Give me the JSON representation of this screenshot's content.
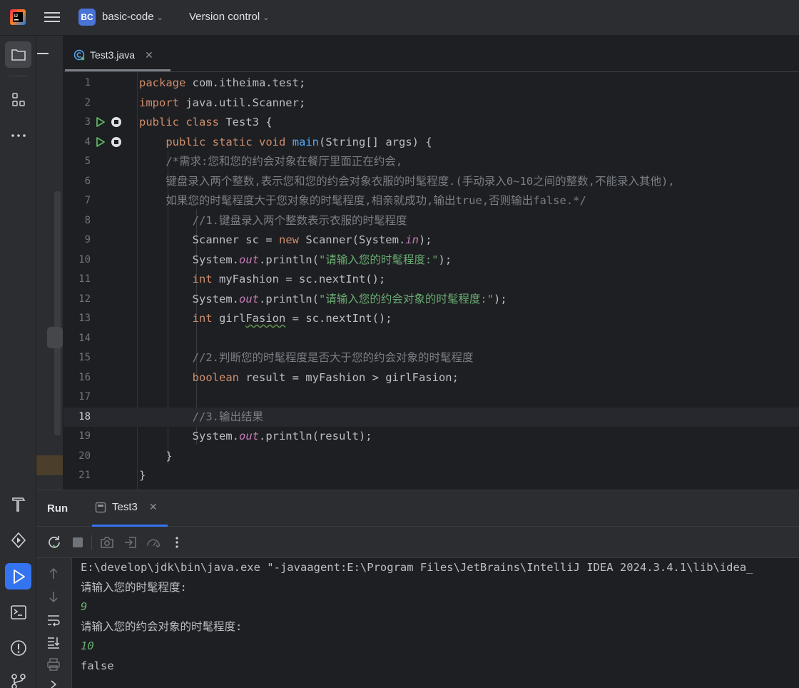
{
  "topbar": {
    "project_badge": "BC",
    "project_name": "basic-code",
    "vcs_label": "Version control",
    "icons": [
      "intellij-logo-icon",
      "main-menu-icon",
      "chevron-down-icon"
    ]
  },
  "left_strip": {
    "items": [
      {
        "name": "project-icon",
        "active": true
      },
      {
        "name": "structure-icon"
      },
      {
        "name": "more-icon"
      },
      {
        "name": "build-icon"
      },
      {
        "name": "services-icon"
      },
      {
        "name": "run-icon",
        "active": true
      },
      {
        "name": "terminal-icon"
      },
      {
        "name": "problems-icon"
      },
      {
        "name": "git-icon"
      }
    ]
  },
  "editor": {
    "tab_label": "Test3.java",
    "current_line": 18,
    "line_numbers": [
      "1",
      "2",
      "3",
      "4",
      "5",
      "6",
      "7",
      "8",
      "9",
      "10",
      "11",
      "12",
      "13",
      "14",
      "15",
      "16",
      "17",
      "18",
      "19",
      "20",
      "21"
    ],
    "lines": {
      "l1": {
        "kw": "package",
        "rest": " com.itheima.test;"
      },
      "l2": {
        "kw": "import",
        "rest": " java.util.Scanner;"
      },
      "l3": {
        "kw1": "public",
        "kw2": "class",
        "rest": " Test3 {"
      },
      "l4": {
        "kw1": "public",
        "kw2": "static",
        "kw3": "void",
        "fn": "main",
        "rest": "(String[] args) {"
      },
      "l5": "/*需求:您和您的约会对象在餐厅里面正在约会,",
      "l6": "键盘录入两个整数,表示您和您的约会对象衣服的时髦程度.(手动录入0~10之间的整数,不能录入其他),",
      "l7": "如果您的时髦程度大于您对象的时髦程度,相亲就成功,输出true,否则输出false.*/",
      "l8": "//1.键盘录入两个整数表示衣服的时髦程度",
      "l9": {
        "a": "Scanner sc = ",
        "kw": "new",
        "b": " Scanner(System.",
        "static": "in",
        "c": ");"
      },
      "l10": {
        "a": "System.",
        "static": "out",
        "b": ".println(",
        "str": "\"请输入您的时髦程度:\"",
        "c": ");"
      },
      "l11": {
        "kw": "int",
        "rest": " myFashion = sc.nextInt();"
      },
      "l12": {
        "a": "System.",
        "static": "out",
        "b": ".println(",
        "str": "\"请输入您的约会对象的时髦程度:\"",
        "c": ");"
      },
      "l13": {
        "kw": "int",
        "a": " girl",
        "squiggle": "Fasion",
        "b": " = sc.nextInt();"
      },
      "l15": "//2.判断您的时髦程度是否大于您的约会对象的时髦程度",
      "l16": {
        "kw": "boolean",
        "rest": " result = myFashion > girlFasion;"
      },
      "l18": "//3.输出结果",
      "l19": {
        "a": "System.",
        "static": "out",
        "b": ".println(result);"
      },
      "l20": "}",
      "l21": "}"
    }
  },
  "run_window": {
    "title": "Run",
    "tab_label": "Test3",
    "toolbar_icons": [
      "rerun-icon",
      "stop-icon",
      "screenshot-icon",
      "restore-layout-icon",
      "profiler-icon",
      "more-vertical-icon"
    ],
    "side_icons": [
      "scroll-up-icon",
      "scroll-down-icon",
      "soft-wrap-icon",
      "scroll-to-end-icon",
      "print-icon",
      "expand-icon"
    ],
    "console": [
      {
        "text": "E:\\develop\\jdk\\bin\\java.exe \"-javaagent:E:\\Program Files\\JetBrains\\IntelliJ IDEA 2024.3.4.1\\lib\\idea_",
        "type": "output"
      },
      {
        "text": "请输入您的时髦程度:",
        "type": "output"
      },
      {
        "text": "9",
        "type": "input"
      },
      {
        "text": "请输入您的约会对象的时髦程度:",
        "type": "output"
      },
      {
        "text": "10",
        "type": "input"
      },
      {
        "text": "false",
        "type": "output"
      }
    ]
  }
}
